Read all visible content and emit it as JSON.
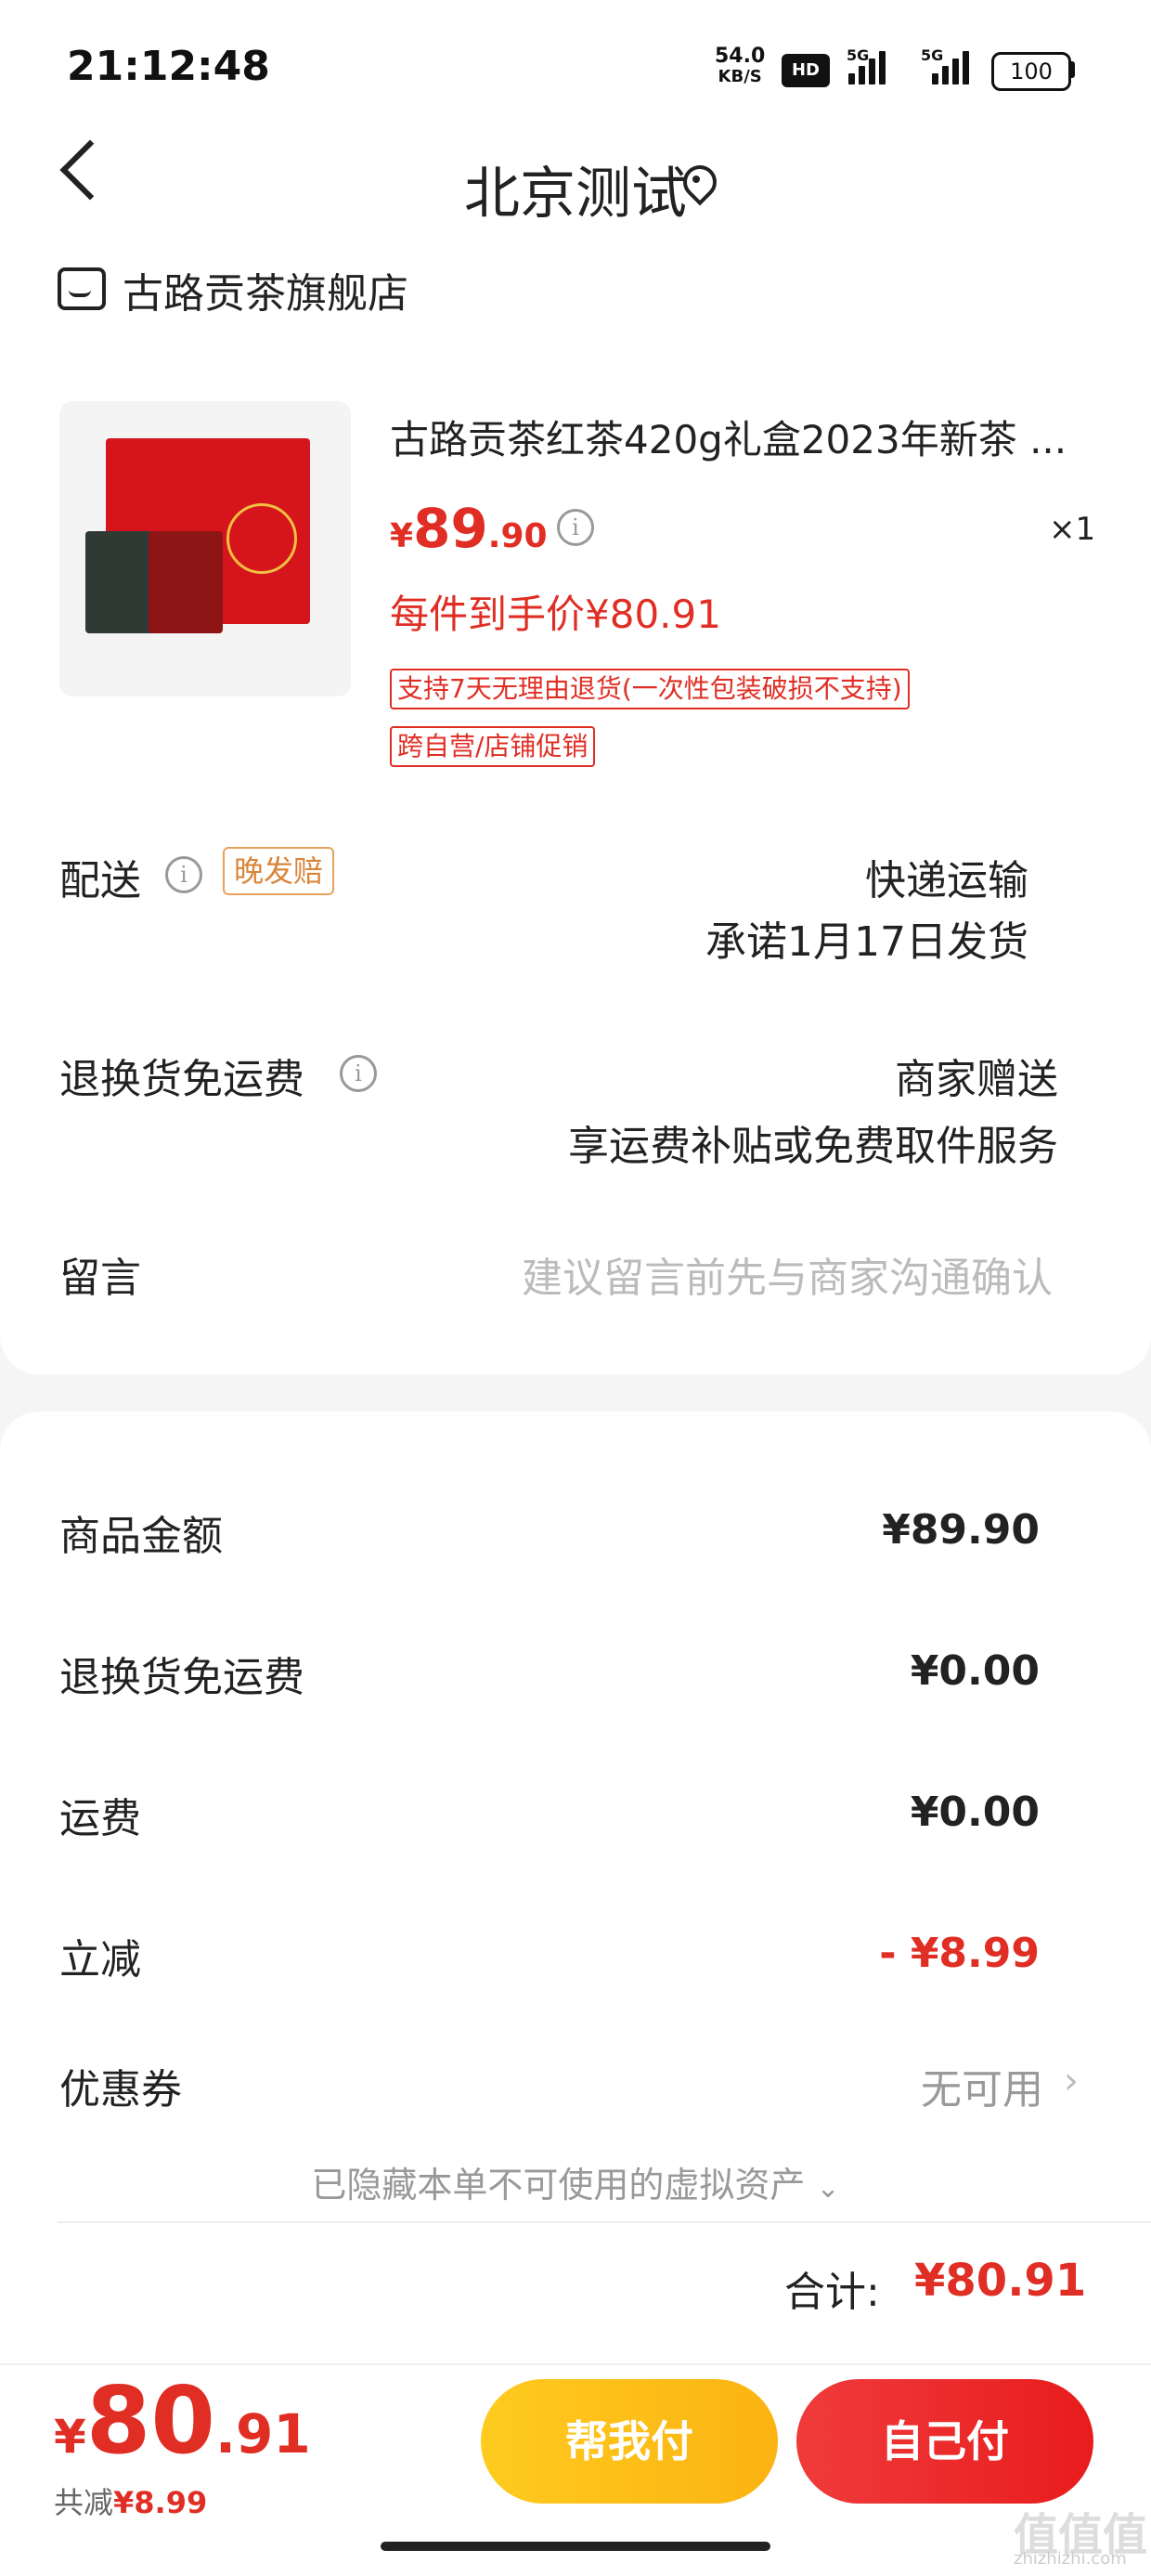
{
  "status_bar": {
    "time": "21:12:48",
    "net_speed": "54.0",
    "net_unit": "KB/S",
    "hd": "HD",
    "sim1": "5G",
    "sim2": "5G",
    "battery": "100"
  },
  "header": {
    "title": "北京测试"
  },
  "store": {
    "name": "古路贡茶旗舰店"
  },
  "product": {
    "name": "古路贡茶红茶420g礼盒2023年新茶 ...",
    "price_symbol": "¥",
    "price_int": "89",
    "price_dec": ".90",
    "quantity": "×1",
    "unit_price_text": "每件到手价¥80.91",
    "tags": [
      "支持7天无理由退货(一次性包装破损不支持)",
      "跨自营/店铺促销"
    ]
  },
  "delivery": {
    "label": "配送",
    "late_tag": "晚发赔",
    "method": "快递运输",
    "promise": "承诺1月17日发货"
  },
  "return_shipping": {
    "label": "退换货免运费",
    "value": "商家赠送",
    "detail": "享运费补贴或免费取件服务"
  },
  "message": {
    "label": "留言",
    "placeholder": "建议留言前先与商家沟通确认"
  },
  "summary": {
    "goods_label": "商品金额",
    "goods_value": "¥89.90",
    "return_label": "退换货免运费",
    "return_value": "¥0.00",
    "shipping_label": "运费",
    "shipping_value": "¥0.00",
    "discount_label": "立减",
    "discount_value": "- ¥8.99",
    "coupon_label": "优惠券",
    "coupon_value": "无可用",
    "hidden_note": "已隐藏本单不可使用的虚拟资产",
    "total_label": "合计:",
    "total_value": "¥80.91"
  },
  "bottom": {
    "price_symbol": "¥",
    "price_int": "80",
    "price_dec": ".91",
    "saved_label": "共减",
    "saved_value": "¥8.99",
    "help_pay": "帮我付",
    "self_pay": "自己付"
  },
  "watermark": {
    "text": "值值值",
    "site": "zhizhizhi.com"
  },
  "colors": {
    "accent_red": "#e02e24",
    "help_yellow": "#fbb312",
    "late_tag_orange": "#d9853a"
  }
}
